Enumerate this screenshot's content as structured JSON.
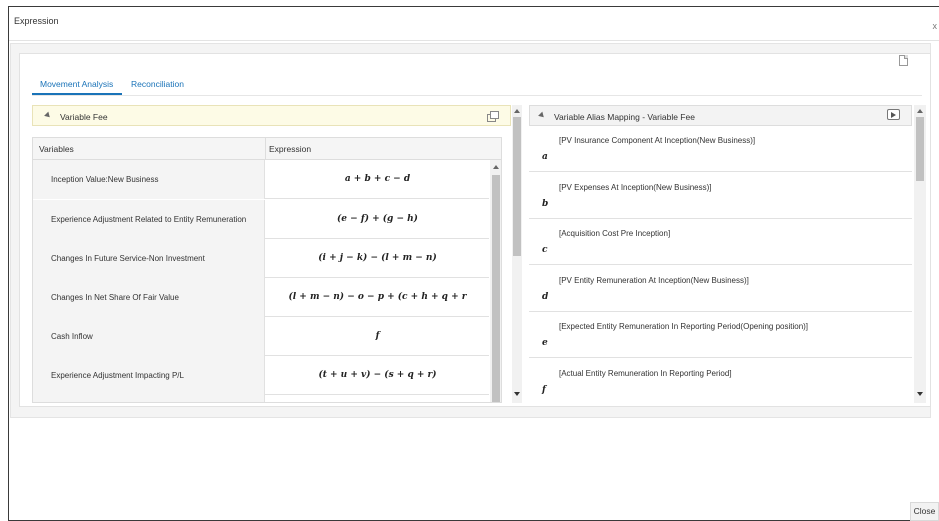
{
  "dialog": {
    "title": "Expression",
    "close_x": "x"
  },
  "tabs": [
    {
      "label": "Movement Analysis",
      "active": true
    },
    {
      "label": "Reconciliation",
      "active": false
    }
  ],
  "left_panel": {
    "title": "Variable Fee",
    "columns": [
      "Variables",
      "Expression"
    ],
    "rows": [
      {
        "variable": "Inception Value:New Business",
        "expression": "a + b + c − d"
      },
      {
        "variable": "Experience Adjustment Related to Entity Remuneration",
        "expression": "(e − f) + (g − h)"
      },
      {
        "variable": "Changes In Future Service-Non Investment",
        "expression": "(i + j − k) − (l + m − n)"
      },
      {
        "variable": "Changes In Net Share Of Fair Value",
        "expression": "(l + m − n) − o − p + (c + h + q + r"
      },
      {
        "variable": "Cash Inflow",
        "expression": "f"
      },
      {
        "variable": "Experience Adjustment Impacting P/L",
        "expression": "(t + u + v) − (s + q + r)"
      }
    ]
  },
  "right_panel": {
    "title": "Variable Alias Mapping - Variable Fee",
    "rows": [
      {
        "alias": "a",
        "text": "[PV Insurance Component At Inception(New Business)]"
      },
      {
        "alias": "b",
        "text": "[PV Expenses At Inception(New Business)]"
      },
      {
        "alias": "c",
        "text": "[Acquisition Cost Pre Inception]"
      },
      {
        "alias": "d",
        "text": "[PV Entity Remuneration At Inception(New Business)]"
      },
      {
        "alias": "e",
        "text": "[Expected Entity Remuneration In Reporting Period(Opening position)]"
      },
      {
        "alias": "f",
        "text": "[Actual Entity Remuneration In Reporting Period]"
      }
    ]
  },
  "footer": {
    "close_label": "Close"
  },
  "colors": {
    "accent": "#1a73b8",
    "panel_header_yellow": "#fdfbe6"
  },
  "icons": [
    "collapse-triangle-icon",
    "detach-icon",
    "pdf-export-icon",
    "expand-icon"
  ]
}
